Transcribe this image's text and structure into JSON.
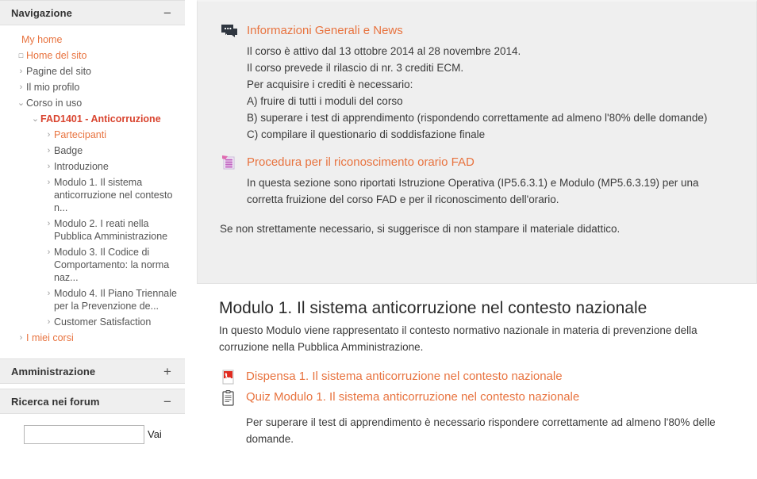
{
  "sidebar": {
    "blocks": [
      {
        "title": "Navigazione",
        "toggle": "−",
        "toggle_name": "collapse-icon"
      },
      {
        "title": "Amministrazione",
        "toggle": "+",
        "toggle_name": "expand-icon"
      },
      {
        "title": "Ricerca nei forum",
        "toggle": "−",
        "toggle_name": "collapse-icon"
      }
    ],
    "nav_items": [
      {
        "label": "My home",
        "level": 0,
        "marker": "",
        "style": "link"
      },
      {
        "label": "Home del sito",
        "level": 1,
        "marker": "□",
        "style": "link"
      },
      {
        "label": "Pagine del sito",
        "level": 1,
        "marker": "›",
        "style": "plain"
      },
      {
        "label": "Il mio profilo",
        "level": 1,
        "marker": "›",
        "style": "plain"
      },
      {
        "label": "Corso in uso",
        "level": 1,
        "marker": "⌄",
        "style": "plain"
      },
      {
        "label": "FAD1401 - Anticorruzione",
        "level": 2,
        "marker": "⌄",
        "style": "strong"
      },
      {
        "label": "Partecipanti",
        "level": 3,
        "marker": "›",
        "style": "sub"
      },
      {
        "label": "Badge",
        "level": 3,
        "marker": "›",
        "style": "plain"
      },
      {
        "label": "Introduzione",
        "level": 3,
        "marker": "›",
        "style": "plain"
      },
      {
        "label": "Modulo 1. Il sistema anticorruzione nel contesto n...",
        "level": 3,
        "marker": "›",
        "style": "plain"
      },
      {
        "label": "Modulo 2. I reati nella Pubblica Amministrazione",
        "level": 3,
        "marker": "›",
        "style": "plain"
      },
      {
        "label": "Modulo 3. Il Codice di Comportamento: la norma naz...",
        "level": 3,
        "marker": "›",
        "style": "plain"
      },
      {
        "label": "Modulo 4. Il Piano Triennale per la Prevenzione de...",
        "level": 3,
        "marker": "›",
        "style": "plain"
      },
      {
        "label": "Customer Satisfaction",
        "level": 3,
        "marker": "›",
        "style": "plain"
      },
      {
        "label": "I miei corsi",
        "level": 1,
        "marker": "›",
        "style": "link"
      }
    ],
    "search": {
      "value": "",
      "placeholder": "",
      "go_label": "Vai"
    }
  },
  "main": {
    "general": {
      "icon": "forum-icon",
      "link": "Informazioni Generali e News",
      "lines": [
        "Il corso è attivo dal 13 ottobre 2014 al 28 novembre 2014.",
        "Il corso prevede il rilascio di nr. 3 crediti ECM.",
        "Per acquisire i crediti è necessario:",
        "A) fruire di tutti i moduli del corso",
        "B) superare i test di apprendimento (rispondendo correttamente ad almeno l'80% delle domande)",
        "C) compilare il questionario di soddisfazione finale"
      ]
    },
    "fad": {
      "icon": "folder-resource-icon",
      "link": "Procedura per il riconoscimento orario FAD",
      "body": "In questa sezione sono riportati Istruzione Operativa (IP5.6.3.1) e Modulo (MP5.6.3.19) per una corretta fruizione del corso FAD e per il riconoscimento dell'orario.",
      "note": "Se non strettamente necessario, si suggerisce di non stampare il materiale didattico."
    },
    "modulo1": {
      "title": "Modulo 1. Il sistema anticorruzione nel contesto nazionale",
      "description": "In questo Modulo viene rappresentato il contesto normativo nazionale in materia di prevenzione della corruzione nella Pubblica Amministrazione.",
      "pdf": {
        "icon": "pdf-icon",
        "link": "Dispensa 1. Il sistema anticorruzione nel contesto nazionale"
      },
      "quiz": {
        "icon": "quiz-clipboard-icon",
        "link": "Quiz Modulo 1. Il sistema anticorruzione nel contesto nazionale",
        "note": "Per superare il test di apprendimento è necessario rispondere correttamente ad almeno l'80% delle domande."
      }
    }
  },
  "colors": {
    "link": "#e8733f",
    "strong_link": "#d9442f",
    "panel_bg": "#efefef",
    "text": "#3a3a3a"
  }
}
